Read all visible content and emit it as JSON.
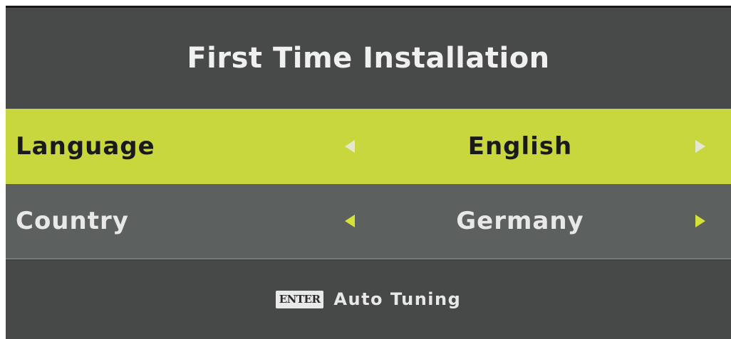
{
  "menu": {
    "title": "First Time Installation",
    "rows": [
      {
        "label": "Language",
        "value": "English",
        "selected": true,
        "left_icon": "arrow-left-icon",
        "right_icon": "arrow-right-icon"
      },
      {
        "label": "Country",
        "value": "Germany",
        "selected": false,
        "left_icon": "arrow-left-icon",
        "right_icon": "arrow-right-icon"
      }
    ],
    "footer": {
      "key_label": "ENTER",
      "action_label": "Auto Tuning"
    }
  },
  "colors": {
    "background": "#444745",
    "highlight": "#c9d73e",
    "row_normal": "#5c605e",
    "arrow_accent": "#d4e23c",
    "text_light": "#e8e8e8",
    "text_dark": "#1a1a1a"
  }
}
